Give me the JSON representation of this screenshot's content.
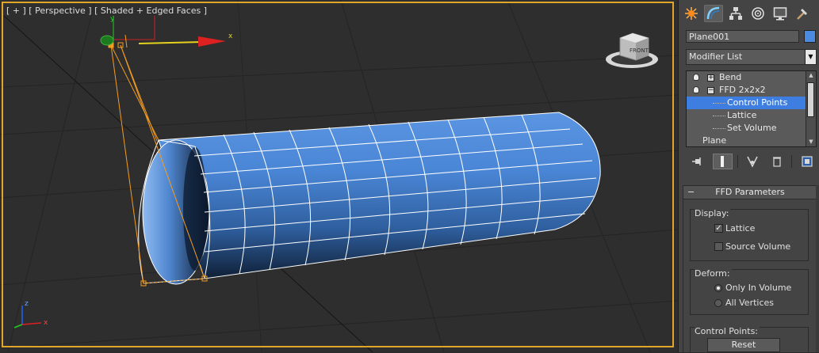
{
  "viewport": {
    "label": {
      "plus": "[ + ]",
      "view": "[ Perspective ]",
      "shading": "[ Shaded + Edged Faces ]"
    },
    "viewcube_face": "FRONT",
    "gizmo_axis_x": "x",
    "gizmo_axis_y": "y",
    "mini_axis_x": "x",
    "mini_axis_z": "z",
    "colors": {
      "mesh_blue": "#4a88d8",
      "lattice": "#f39c22",
      "selection_border": "#e0a52a"
    }
  },
  "command_panel": {
    "tabs": [
      {
        "name": "create-tab",
        "icon": "sparkle-icon"
      },
      {
        "name": "modify-tab",
        "icon": "modify-arc-icon",
        "active": true
      },
      {
        "name": "hierarchy-tab",
        "icon": "hierarchy-icon"
      },
      {
        "name": "motion-tab",
        "icon": "motion-icon"
      },
      {
        "name": "display-tab",
        "icon": "monitor-icon"
      },
      {
        "name": "utilities-tab",
        "icon": "hammer-icon"
      }
    ],
    "object_name": "Plane001",
    "object_color": "#4a8ae0",
    "modifier_list": "Modifier List",
    "stack": {
      "bend": "Bend",
      "ffd": "FFD 2x2x2",
      "control_points": "Control Points",
      "lattice": "Lattice",
      "set_volume": "Set Volume",
      "plane": "Plane"
    },
    "rollout": {
      "title": "FFD Parameters",
      "display_group": "Display:",
      "lattice_label": "Lattice",
      "lattice_checked": true,
      "source_volume_label": "Source Volume",
      "source_volume_checked": false,
      "deform_group": "Deform:",
      "only_in_volume": "Only In Volume",
      "all_vertices": "All Vertices",
      "deform_selected": "Only In Volume",
      "control_points_group": "Control Points:",
      "reset_label": "Reset"
    }
  }
}
